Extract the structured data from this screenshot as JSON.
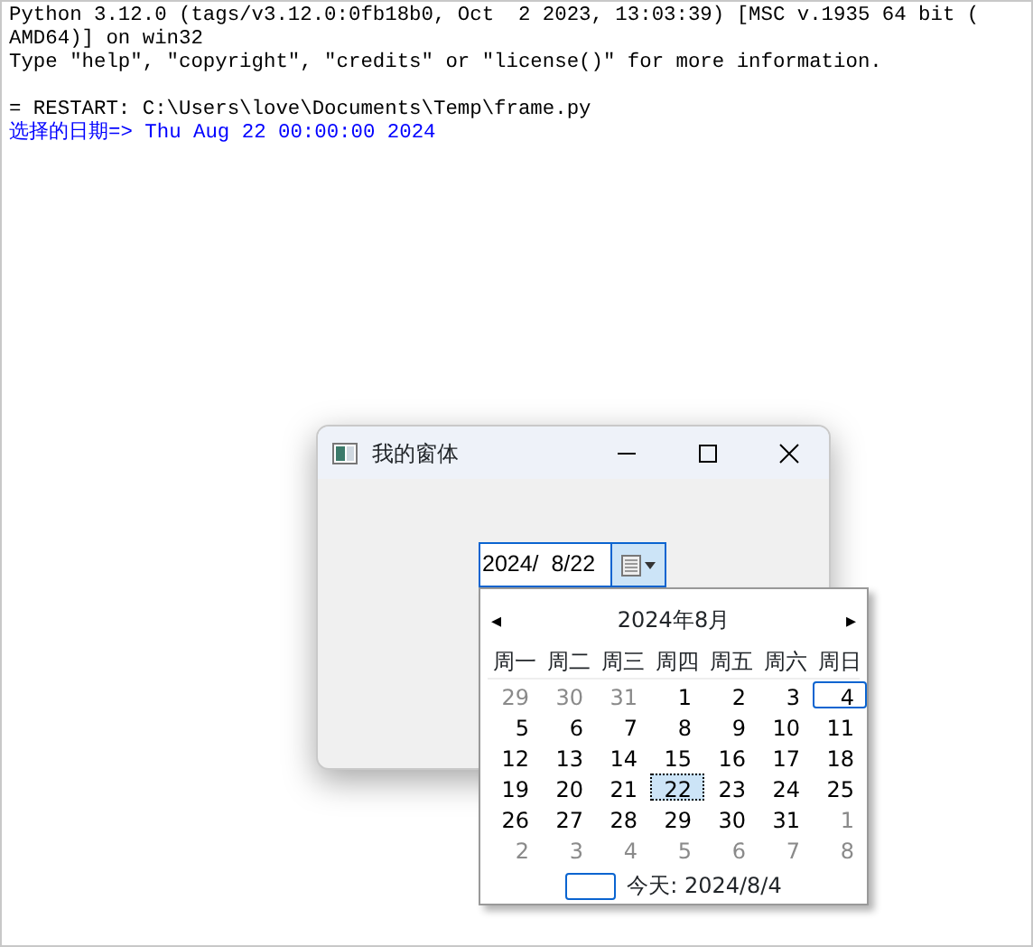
{
  "shell": {
    "lines": [
      {
        "kind": "output",
        "text": "Python 3.12.0 (tags/v3.12.0:0fb18b0, Oct  2 2023, 13:03:39) [MSC v.1935 64 bit ("
      },
      {
        "kind": "output",
        "text": "AMD64)] on win32"
      },
      {
        "kind": "output",
        "text": "Type \"help\", \"copyright\", \"credits\" or \"license()\" for more information."
      },
      {
        "kind": "blank"
      },
      {
        "kind": "output",
        "text": "= RESTART: C:\\Users\\love\\Documents\\Temp\\frame.py"
      },
      {
        "kind": "result",
        "text": "选择的日期=> Thu Aug 22 00:00:00 2024"
      }
    ]
  },
  "window": {
    "title": "我的窗体",
    "date_field": {
      "value": "2024/  8/22"
    }
  },
  "calendar": {
    "prev": "◂",
    "next": "▸",
    "month": "2024年8月",
    "weekdays": [
      "周一",
      "周二",
      "周三",
      "周四",
      "周五",
      "周六",
      "周日"
    ],
    "days": [
      {
        "text": "29",
        "muted": true,
        "selected": false,
        "today": false
      },
      {
        "text": "30",
        "muted": true,
        "selected": false,
        "today": false
      },
      {
        "text": "31",
        "muted": true,
        "selected": false,
        "today": false
      },
      {
        "text": "1",
        "muted": false,
        "selected": false,
        "today": false
      },
      {
        "text": "2",
        "muted": false,
        "selected": false,
        "today": false
      },
      {
        "text": "3",
        "muted": false,
        "selected": false,
        "today": false
      },
      {
        "text": "4",
        "muted": false,
        "selected": false,
        "today": true
      },
      {
        "text": "5",
        "muted": false,
        "selected": false,
        "today": false
      },
      {
        "text": "6",
        "muted": false,
        "selected": false,
        "today": false
      },
      {
        "text": "7",
        "muted": false,
        "selected": false,
        "today": false
      },
      {
        "text": "8",
        "muted": false,
        "selected": false,
        "today": false
      },
      {
        "text": "9",
        "muted": false,
        "selected": false,
        "today": false
      },
      {
        "text": "10",
        "muted": false,
        "selected": false,
        "today": false
      },
      {
        "text": "11",
        "muted": false,
        "selected": false,
        "today": false
      },
      {
        "text": "12",
        "muted": false,
        "selected": false,
        "today": false
      },
      {
        "text": "13",
        "muted": false,
        "selected": false,
        "today": false
      },
      {
        "text": "14",
        "muted": false,
        "selected": false,
        "today": false
      },
      {
        "text": "15",
        "muted": false,
        "selected": false,
        "today": false
      },
      {
        "text": "16",
        "muted": false,
        "selected": false,
        "today": false
      },
      {
        "text": "17",
        "muted": false,
        "selected": false,
        "today": false
      },
      {
        "text": "18",
        "muted": false,
        "selected": false,
        "today": false
      },
      {
        "text": "19",
        "muted": false,
        "selected": false,
        "today": false
      },
      {
        "text": "20",
        "muted": false,
        "selected": false,
        "today": false
      },
      {
        "text": "21",
        "muted": false,
        "selected": false,
        "today": false
      },
      {
        "text": "22",
        "muted": false,
        "selected": true,
        "today": false
      },
      {
        "text": "23",
        "muted": false,
        "selected": false,
        "today": false
      },
      {
        "text": "24",
        "muted": false,
        "selected": false,
        "today": false
      },
      {
        "text": "25",
        "muted": false,
        "selected": false,
        "today": false
      },
      {
        "text": "26",
        "muted": false,
        "selected": false,
        "today": false
      },
      {
        "text": "27",
        "muted": false,
        "selected": false,
        "today": false
      },
      {
        "text": "28",
        "muted": false,
        "selected": false,
        "today": false
      },
      {
        "text": "29",
        "muted": false,
        "selected": false,
        "today": false
      },
      {
        "text": "30",
        "muted": false,
        "selected": false,
        "today": false
      },
      {
        "text": "31",
        "muted": false,
        "selected": false,
        "today": false
      },
      {
        "text": "1",
        "muted": true,
        "selected": false,
        "today": false
      },
      {
        "text": "2",
        "muted": true,
        "selected": false,
        "today": false
      },
      {
        "text": "3",
        "muted": true,
        "selected": false,
        "today": false
      },
      {
        "text": "4",
        "muted": true,
        "selected": false,
        "today": false
      },
      {
        "text": "5",
        "muted": true,
        "selected": false,
        "today": false
      },
      {
        "text": "6",
        "muted": true,
        "selected": false,
        "today": false
      },
      {
        "text": "7",
        "muted": true,
        "selected": false,
        "today": false
      },
      {
        "text": "8",
        "muted": true,
        "selected": false,
        "today": false
      }
    ],
    "today_label": "今天: 2024/8/4"
  }
}
